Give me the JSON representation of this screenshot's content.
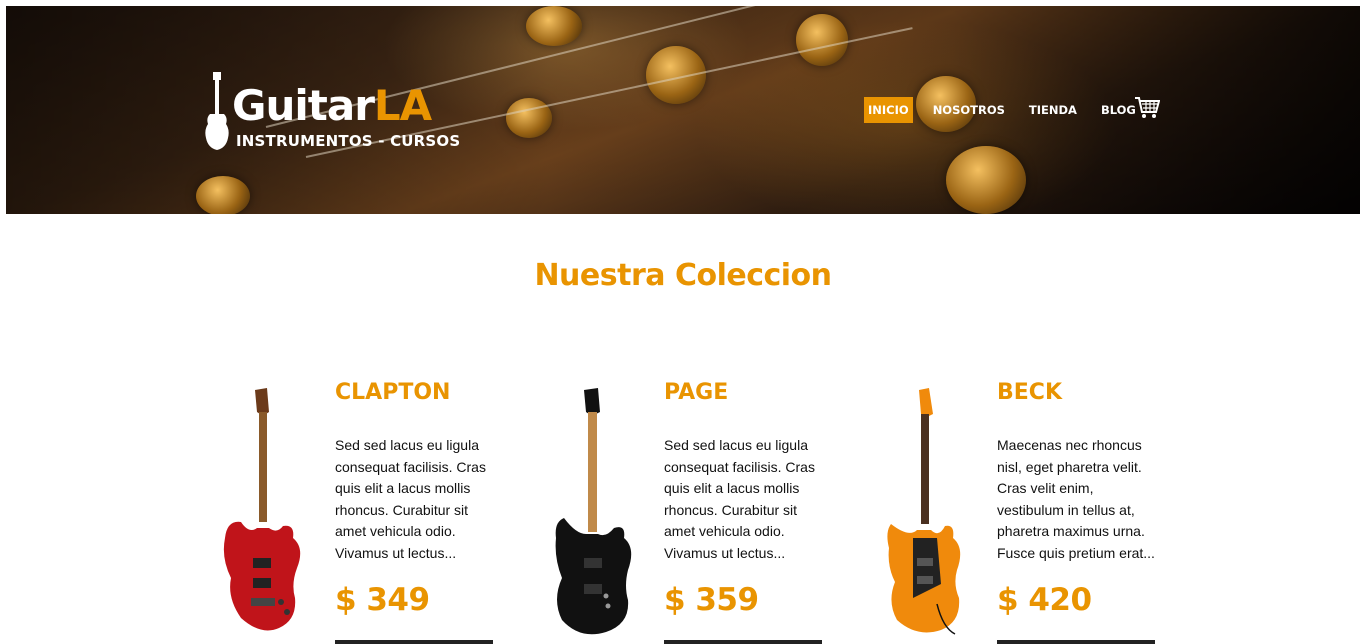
{
  "header": {
    "logo": {
      "main": "Guitar",
      "accent": "LA",
      "tagline": "INSTRUMENTOS - CURSOS"
    },
    "nav": [
      {
        "label": "INICIO",
        "active": true
      },
      {
        "label": "NOSOTROS",
        "active": false
      },
      {
        "label": "TIENDA",
        "active": false
      },
      {
        "label": "BLOG",
        "active": false
      }
    ],
    "cart_icon": "cart-icon"
  },
  "main": {
    "title": "Nuestra Coleccion",
    "products": [
      {
        "name": "CLAPTON",
        "description": "Sed sed lacus eu ligula consequat facilisis. Cras quis elit a lacus mollis rhoncus. Curabitur sit amet vehicula odio. Vivamus ut lectus...",
        "price": "$ 349",
        "color": "#c0141a"
      },
      {
        "name": "PAGE",
        "description": "Sed sed lacus eu ligula consequat facilisis. Cras quis elit a lacus mollis rhoncus. Curabitur sit amet vehicula odio. Vivamus ut lectus...",
        "price": "$ 359",
        "color": "#111111"
      },
      {
        "name": "BECK",
        "description": "Maecenas nec rhoncus nisl, eget pharetra velit. Cras velit enim, vestibulum in tellus at, pharetra maximus urna. Fusce quis pretium erat...",
        "price": "$ 420",
        "color": "#f08a0c"
      }
    ]
  },
  "colors": {
    "accent": "#e99401",
    "text": "#111111",
    "white": "#ffffff"
  }
}
